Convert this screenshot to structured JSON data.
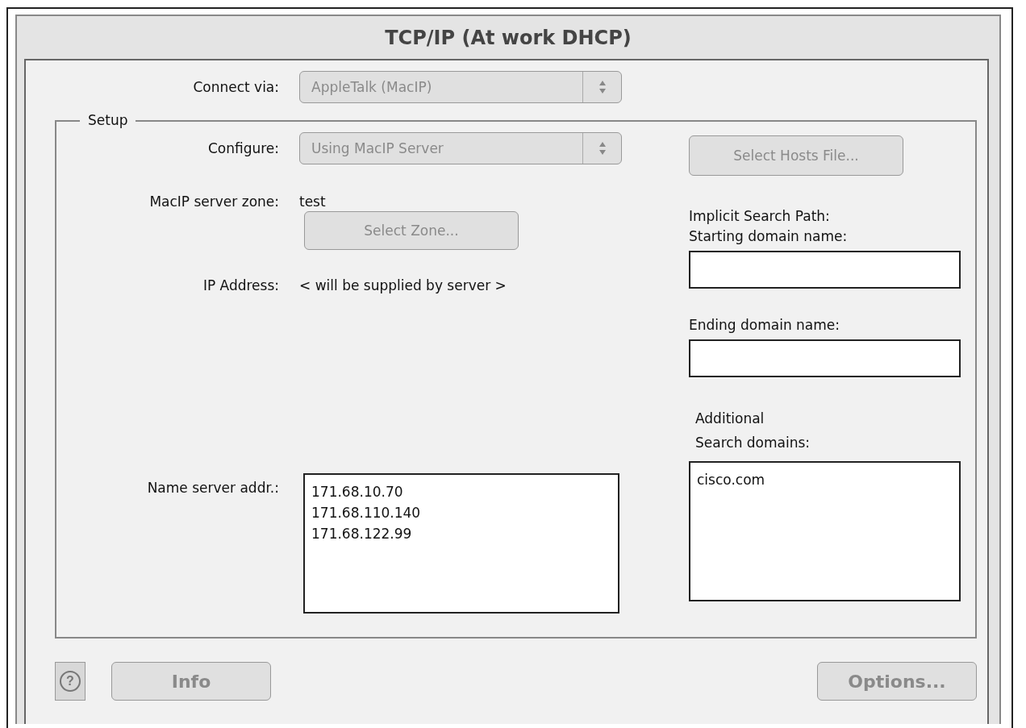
{
  "window": {
    "title": "TCP/IP (At work DHCP)"
  },
  "connect_via": {
    "label": "Connect via:",
    "value": "AppleTalk (MacIP)",
    "disabled": true
  },
  "setup": {
    "title": "Setup",
    "configure": {
      "label": "Configure:",
      "value": "Using MacIP Server",
      "disabled": true
    },
    "zone": {
      "label": "MacIP server zone:",
      "value": "test"
    },
    "select_zone_button": {
      "label": "Select Zone...",
      "disabled": true
    },
    "ip_address": {
      "label": "IP Address:",
      "value": "< will be supplied by server >"
    },
    "name_servers": {
      "label": "Name server addr.:",
      "lines": [
        "171.68.10.70",
        "171.68.110.140",
        "171.68.122.99"
      ]
    },
    "select_hosts_button": {
      "label": "Select Hosts File...",
      "disabled": true
    },
    "search_path": {
      "title": "Implicit Search Path:",
      "starting_label": "Starting domain name:",
      "ending_label": "Ending domain name:"
    },
    "additional_domains": {
      "label": "Additional\nSearch domains:",
      "lines": [
        "cisco.com"
      ]
    }
  },
  "buttons": {
    "help": {
      "glyph": "?",
      "disabled": true
    },
    "info": {
      "label": "Info",
      "disabled": true
    },
    "options": {
      "label": "Options...",
      "disabled": true
    }
  }
}
